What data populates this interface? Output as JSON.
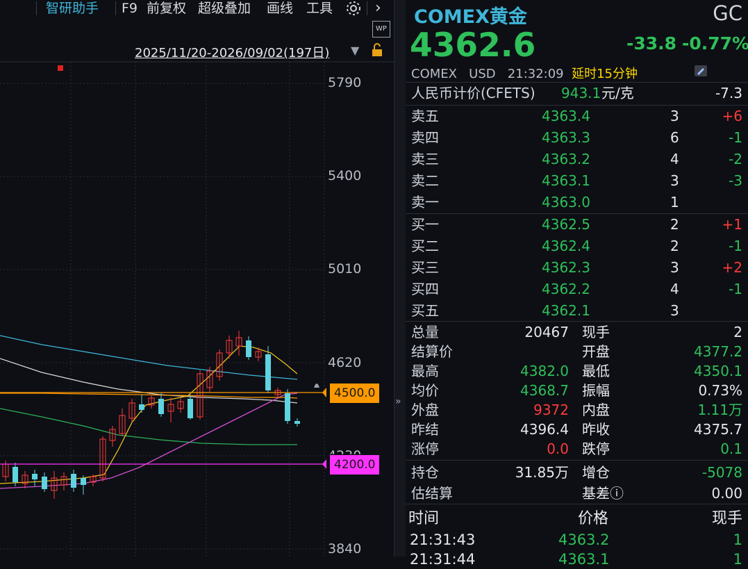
{
  "toolbar": {
    "items": [
      "智研助手",
      "F9",
      "前复权",
      "超级叠加",
      "画线",
      "工具"
    ],
    "more": "›"
  },
  "range": {
    "label": "2025/11/20-2026/09/02(197日)",
    "wp_badge": "WP"
  },
  "axis": {
    "ticks": [
      "5790",
      "5400",
      "5010",
      "4620",
      "4230",
      "3840"
    ]
  },
  "price_lines": {
    "upper": {
      "label": "4500.0",
      "color": "#ff9900"
    },
    "lower": {
      "label": "4200.0",
      "color": "#ff33ff"
    }
  },
  "quote": {
    "name": "COMEX黄金",
    "code": "GC",
    "price": "4362.6",
    "change": "-33.8",
    "change_pct": "-0.77%",
    "exchange": "COMEX",
    "currency": "USD",
    "time": "21:32:09",
    "delay": "延时15分钟",
    "cny_label": "人民币计价(CFETS)",
    "cny_value": "943.1",
    "cny_unit": "元/克",
    "cny_change": "-7.3"
  },
  "asks": [
    {
      "label": "卖五",
      "price": "4363.4",
      "vol": "3",
      "chg": "+6"
    },
    {
      "label": "卖四",
      "price": "4363.3",
      "vol": "6",
      "chg": "-1"
    },
    {
      "label": "卖三",
      "price": "4363.2",
      "vol": "4",
      "chg": "-2"
    },
    {
      "label": "卖二",
      "price": "4363.1",
      "vol": "3",
      "chg": "-3"
    },
    {
      "label": "卖一",
      "price": "4363.0",
      "vol": "1",
      "chg": ""
    }
  ],
  "bids": [
    {
      "label": "买一",
      "price": "4362.5",
      "vol": "2",
      "chg": "+1"
    },
    {
      "label": "买二",
      "price": "4362.4",
      "vol": "2",
      "chg": "-1"
    },
    {
      "label": "买三",
      "price": "4362.3",
      "vol": "3",
      "chg": "+2"
    },
    {
      "label": "买四",
      "price": "4362.2",
      "vol": "4",
      "chg": "-1"
    },
    {
      "label": "买五",
      "price": "4362.1",
      "vol": "3",
      "chg": ""
    }
  ],
  "stats": [
    {
      "l1": "总量",
      "v1": "20467",
      "c1": "white",
      "l2": "现手",
      "v2": "2",
      "c2": "white"
    },
    {
      "l1": "结算价",
      "v1": "",
      "c1": "white",
      "l2": "开盘",
      "v2": "4377.2",
      "c2": "green"
    },
    {
      "l1": "最高",
      "v1": "4382.0",
      "c1": "green",
      "l2": "最低",
      "v2": "4350.1",
      "c2": "green"
    },
    {
      "l1": "均价",
      "v1": "4368.7",
      "c1": "green",
      "l2": "振幅",
      "v2": "0.73%",
      "c2": "white"
    },
    {
      "l1": "外盘",
      "v1": "9372",
      "c1": "red",
      "l2": "内盘",
      "v2": "1.11万",
      "c2": "green"
    },
    {
      "l1": "昨结",
      "v1": "4396.4",
      "c1": "white",
      "l2": "昨收",
      "v2": "4375.7",
      "c2": "white"
    },
    {
      "l1": "涨停",
      "v1": "0.0",
      "c1": "red",
      "l2": "跌停",
      "v2": "0.1",
      "c2": "green"
    }
  ],
  "stats2": [
    {
      "l1": "持仓",
      "v1": "31.85万",
      "c1": "white",
      "l2": "增仓",
      "v2": "-5078",
      "c2": "green"
    },
    {
      "l1": "估结算",
      "v1": "",
      "c1": "white",
      "l2": "基差ⓘ",
      "v2": "0.00",
      "c2": "white"
    }
  ],
  "ticks_header": {
    "time": "时间",
    "price": "价格",
    "vol": "现手"
  },
  "ticks": [
    {
      "time": "21:31:43",
      "price": "4363.2",
      "vol": "1"
    },
    {
      "time": "21:31:44",
      "price": "4363.1",
      "vol": "1"
    }
  ],
  "colors": {
    "accent": "#3fb6d9",
    "up": "#ff3b3b",
    "down": "#2fc05a",
    "candle_down": "#5fd3e0",
    "candle_up": "#ff3b3b"
  }
}
